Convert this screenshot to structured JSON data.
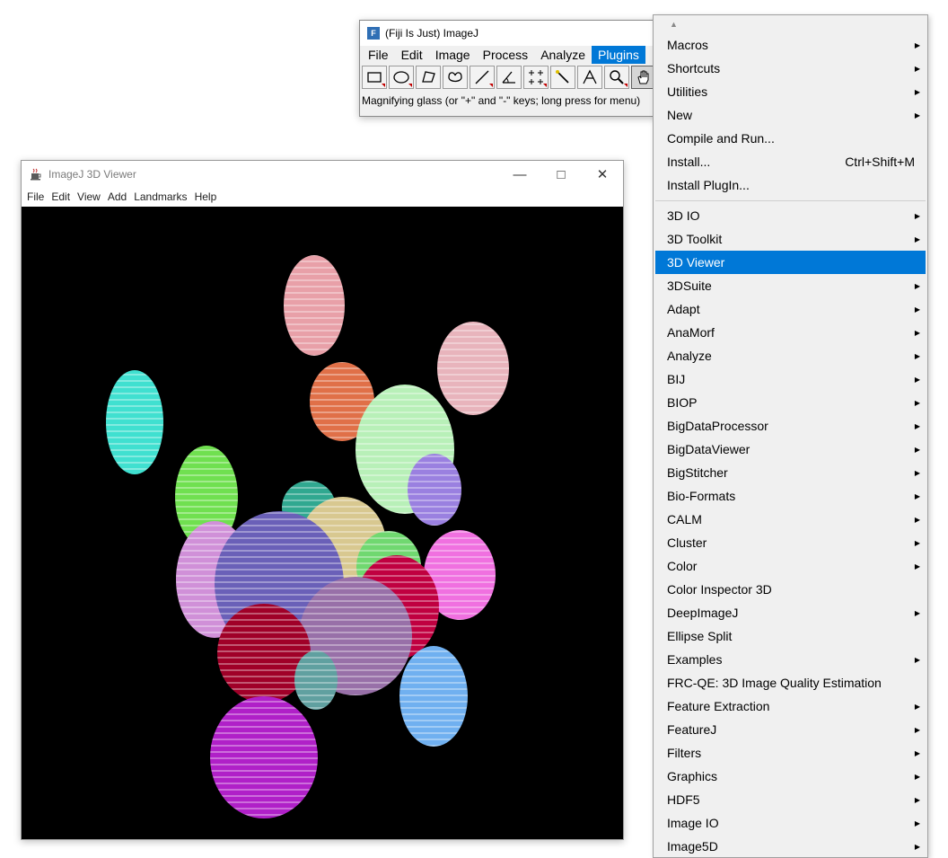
{
  "fiji": {
    "title": "(Fiji Is Just) ImageJ",
    "menus": [
      "File",
      "Edit",
      "Image",
      "Process",
      "Analyze",
      "Plugins"
    ],
    "active_menu": "Plugins",
    "tools": [
      {
        "icon": "rectangle-tool-icon"
      },
      {
        "icon": "oval-tool-icon"
      },
      {
        "icon": "polygon-tool-icon"
      },
      {
        "icon": "freehand-tool-icon"
      },
      {
        "icon": "line-tool-icon"
      },
      {
        "icon": "angle-tool-icon"
      },
      {
        "icon": "point-tool-icon"
      },
      {
        "icon": "wand-tool-icon"
      },
      {
        "icon": "text-tool-icon"
      },
      {
        "icon": "magnifier-tool-icon"
      },
      {
        "icon": "hand-tool-icon"
      }
    ],
    "status": "Magnifying glass (or \"+\" and \"-\" keys; long press for menu)"
  },
  "viewer": {
    "title": "ImageJ 3D Viewer",
    "menus": [
      "File",
      "Edit",
      "View",
      "Add",
      "Landmarks",
      "Help"
    ],
    "blob_colors": [
      "#e8a0a8",
      "#e8b4bc",
      "#40e0d0",
      "#e07048",
      "#b8f0b8",
      "#9a80e0",
      "#70e050",
      "#30a890",
      "#d8c890",
      "#d090d8",
      "#6a60b8",
      "#70d870",
      "#f070e0",
      "#c00040",
      "#9870a8",
      "#a00028",
      "#60a0a0",
      "#70b0f0",
      "#b020c8"
    ]
  },
  "menu": {
    "groups": [
      [
        {
          "label": "Macros",
          "submenu": true
        },
        {
          "label": "Shortcuts",
          "submenu": true
        },
        {
          "label": "Utilities",
          "submenu": true
        },
        {
          "label": "New",
          "submenu": true
        },
        {
          "label": "Compile and Run...",
          "submenu": false
        },
        {
          "label": "Install...",
          "submenu": false,
          "shortcut": "Ctrl+Shift+M"
        },
        {
          "label": "Install PlugIn...",
          "submenu": false
        }
      ],
      [
        {
          "label": "3D IO",
          "submenu": true
        },
        {
          "label": "3D Toolkit",
          "submenu": true
        },
        {
          "label": "3D Viewer",
          "submenu": false,
          "highlighted": true
        },
        {
          "label": "3DSuite",
          "submenu": true
        },
        {
          "label": "Adapt",
          "submenu": true
        },
        {
          "label": "AnaMorf",
          "submenu": true
        },
        {
          "label": "Analyze",
          "submenu": true
        },
        {
          "label": "BIJ",
          "submenu": true
        },
        {
          "label": "BIOP",
          "submenu": true
        },
        {
          "label": "BigDataProcessor",
          "submenu": true
        },
        {
          "label": "BigDataViewer",
          "submenu": true
        },
        {
          "label": "BigStitcher",
          "submenu": true
        },
        {
          "label": "Bio-Formats",
          "submenu": true
        },
        {
          "label": "CALM",
          "submenu": true
        },
        {
          "label": "Cluster",
          "submenu": true
        },
        {
          "label": "Color",
          "submenu": true
        },
        {
          "label": "Color Inspector 3D",
          "submenu": false
        },
        {
          "label": "DeepImageJ",
          "submenu": true
        },
        {
          "label": "Ellipse Split",
          "submenu": false
        },
        {
          "label": "Examples",
          "submenu": true
        },
        {
          "label": "FRC-QE: 3D Image Quality Estimation",
          "submenu": false
        },
        {
          "label": "Feature Extraction",
          "submenu": true
        },
        {
          "label": "FeatureJ",
          "submenu": true
        },
        {
          "label": "Filters",
          "submenu": true
        },
        {
          "label": "Graphics",
          "submenu": true
        },
        {
          "label": "HDF5",
          "submenu": true
        },
        {
          "label": "Image IO",
          "submenu": true
        },
        {
          "label": "Image5D",
          "submenu": true
        }
      ]
    ],
    "highlight_color": "#0078d7"
  }
}
